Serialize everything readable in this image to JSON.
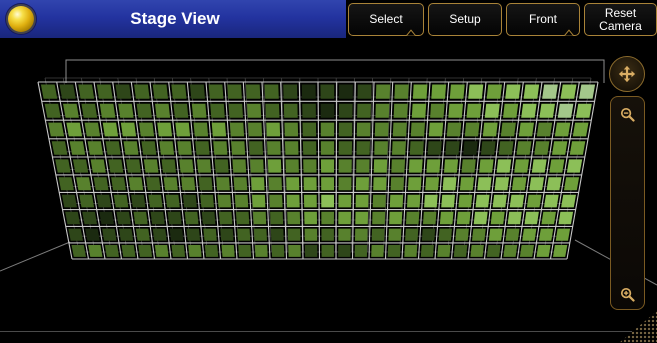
{
  "window": {
    "title": "Stage View",
    "icon": "yellow-sphere-icon"
  },
  "toolbar": {
    "select": "Select",
    "setup": "Setup",
    "front": "Front",
    "reset_camera": [
      "Reset",
      "Camera"
    ],
    "marker_icon": "caret-up-icon"
  },
  "camera_controls": {
    "move_icon": "move-icon",
    "zoom_out_icon": "zoom-out-icon",
    "zoom_in_icon": "zoom-in-icon"
  },
  "theme": {
    "title_bar": "#2333a0",
    "accent": "#a98338",
    "control_icon": "#d9ad63",
    "grid_line": "#dcdcdc",
    "stage_outline": "#bdbdbd",
    "background": "#000000"
  },
  "stage": {
    "fixture_level_colors": [
      "#1b2a10",
      "#2e4619",
      "#426322",
      "#58812d",
      "#6e9f3a",
      "#8cbf58",
      "#a3c78a"
    ],
    "fixture_levels": [
      [
        2,
        1,
        2,
        2,
        1,
        2,
        2,
        2,
        1,
        2,
        2,
        2,
        2,
        1,
        0,
        1,
        0,
        1,
        3,
        3,
        4,
        4,
        4,
        5,
        4,
        5,
        5,
        6,
        5,
        6
      ],
      [
        2,
        3,
        2,
        3,
        3,
        2,
        3,
        2,
        3,
        2,
        2,
        3,
        2,
        2,
        1,
        0,
        1,
        2,
        3,
        3,
        4,
        3,
        4,
        4,
        5,
        4,
        5,
        5,
        6,
        5
      ],
      [
        3,
        4,
        3,
        4,
        4,
        3,
        4,
        4,
        3,
        4,
        3,
        3,
        4,
        3,
        2,
        3,
        2,
        3,
        3,
        3,
        3,
        4,
        3,
        3,
        4,
        3,
        4,
        3,
        4,
        4
      ],
      [
        2,
        3,
        3,
        2,
        3,
        2,
        3,
        3,
        2,
        3,
        3,
        2,
        3,
        3,
        2,
        3,
        2,
        2,
        3,
        3,
        2,
        1,
        1,
        0,
        1,
        2,
        3,
        3,
        4,
        4
      ],
      [
        2,
        2,
        3,
        2,
        2,
        3,
        2,
        3,
        3,
        2,
        3,
        3,
        4,
        3,
        3,
        4,
        3,
        3,
        4,
        3,
        4,
        4,
        4,
        3,
        4,
        5,
        4,
        5,
        4,
        5
      ],
      [
        2,
        3,
        2,
        2,
        3,
        2,
        3,
        3,
        2,
        3,
        3,
        4,
        3,
        4,
        4,
        4,
        3,
        4,
        4,
        3,
        4,
        4,
        5,
        4,
        5,
        5,
        4,
        5,
        5,
        4
      ],
      [
        1,
        2,
        1,
        2,
        1,
        2,
        2,
        1,
        2,
        3,
        3,
        4,
        3,
        4,
        4,
        5,
        4,
        4,
        3,
        4,
        4,
        5,
        5,
        4,
        5,
        5,
        5,
        4,
        5,
        5
      ],
      [
        1,
        1,
        0,
        1,
        2,
        1,
        1,
        2,
        1,
        2,
        2,
        3,
        2,
        3,
        4,
        3,
        4,
        4,
        3,
        4,
        3,
        3,
        4,
        4,
        5,
        4,
        5,
        5,
        4,
        5
      ],
      [
        1,
        0,
        1,
        1,
        2,
        1,
        0,
        1,
        2,
        1,
        2,
        2,
        1,
        2,
        3,
        2,
        3,
        3,
        2,
        3,
        2,
        1,
        2,
        3,
        3,
        4,
        3,
        4,
        4,
        4
      ],
      [
        2,
        3,
        2,
        2,
        2,
        3,
        2,
        3,
        2,
        3,
        2,
        3,
        2,
        3,
        1,
        2,
        1,
        2,
        3,
        2,
        3,
        2,
        3,
        2,
        3,
        2,
        3,
        3,
        4,
        4
      ]
    ]
  }
}
